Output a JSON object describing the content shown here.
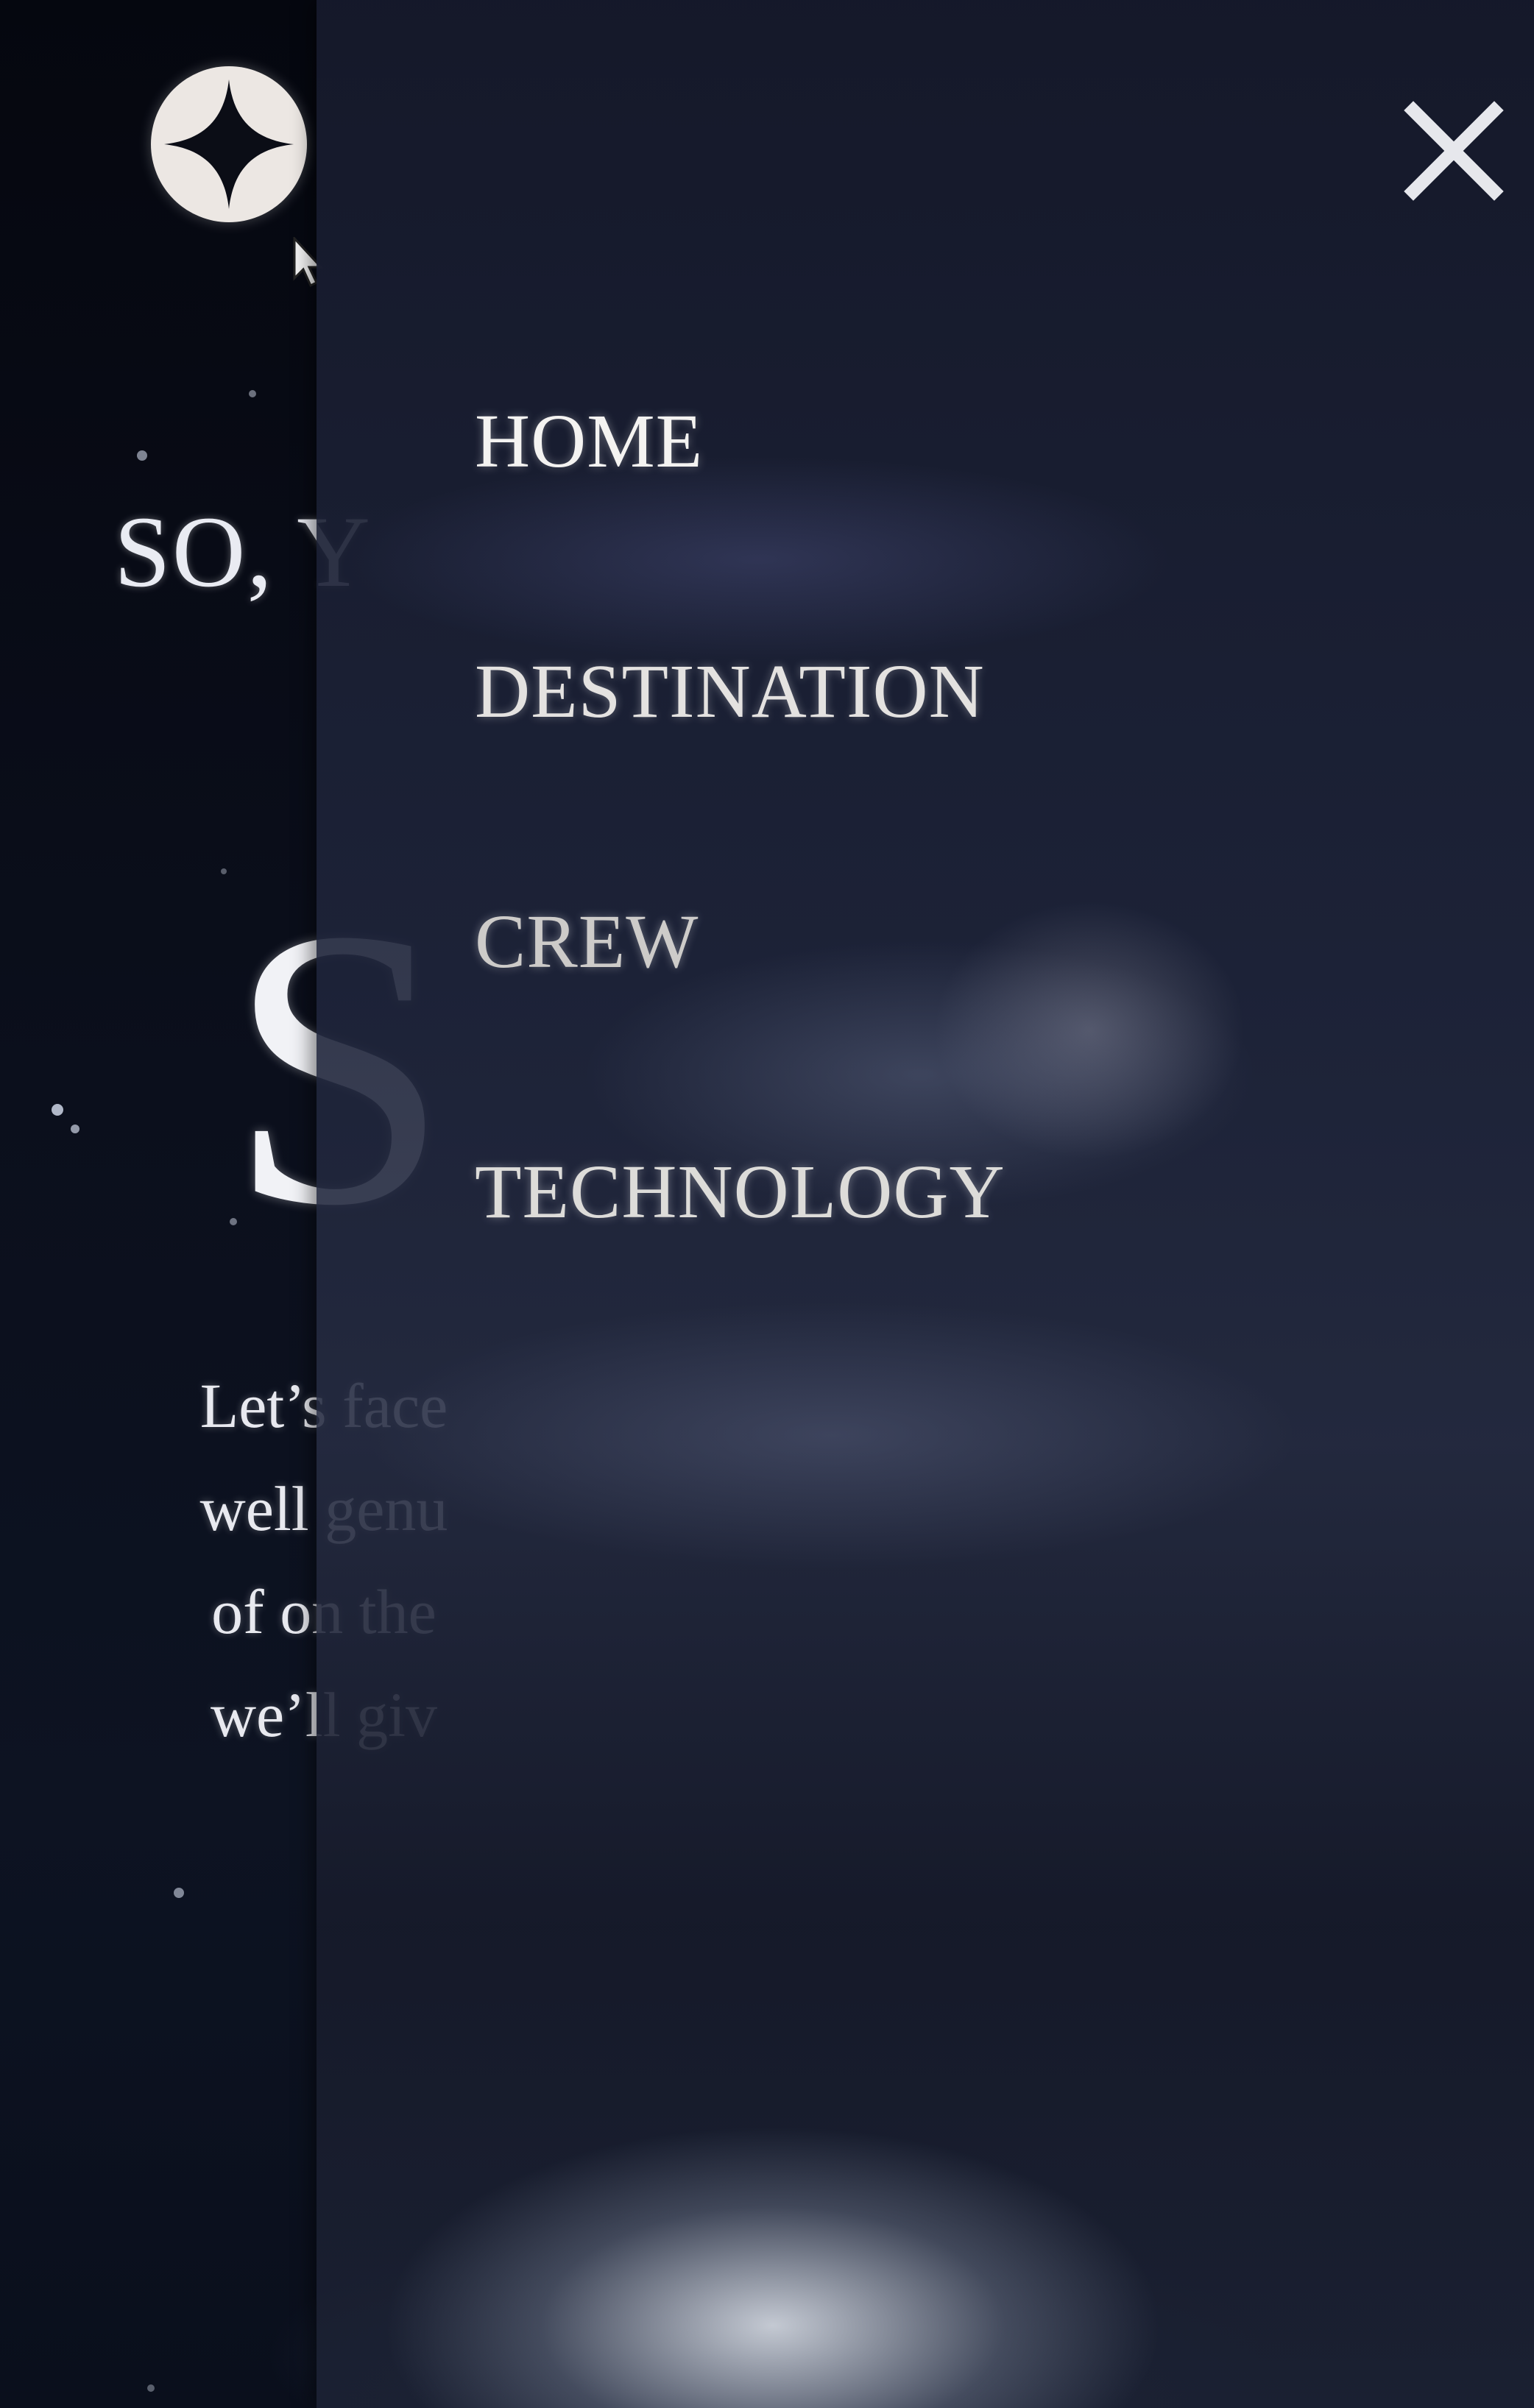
{
  "logo": {
    "icon": "four-point-star-icon"
  },
  "hero": {
    "eyebrow": "SO, Y",
    "title": "S",
    "body_lines": [
      "Let’s face",
      "well genu",
      "of on the",
      "we’ll giv"
    ]
  },
  "nav": {
    "close_icon": "close-icon",
    "items": [
      {
        "label": "HOME"
      },
      {
        "label": "DESTINATION"
      },
      {
        "label": "CREW"
      },
      {
        "label": "TECHNOLOGY"
      }
    ]
  },
  "colors": {
    "background": "#05070e",
    "panel": "#1e243a",
    "text": "#f4f3f1"
  }
}
